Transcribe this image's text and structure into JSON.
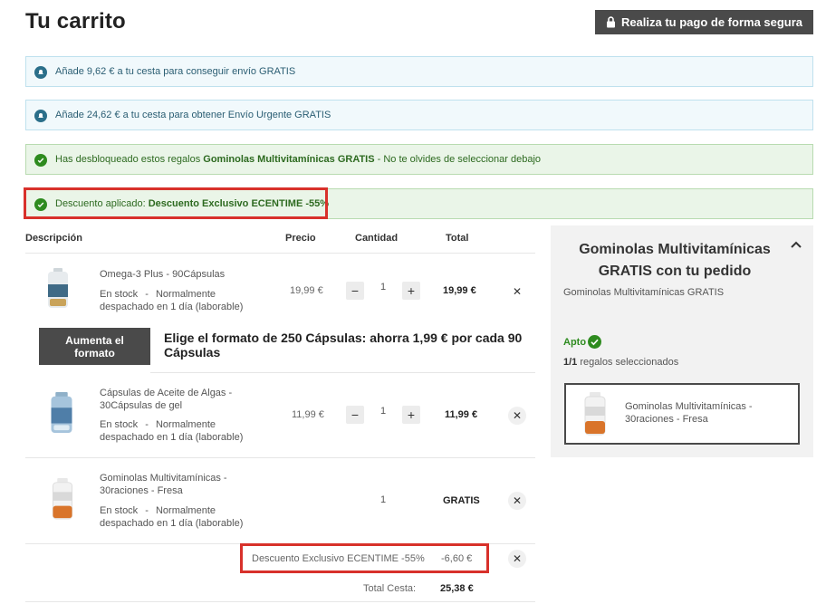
{
  "header": {
    "title": "Tu carrito",
    "secure_pay_label": "Realiza tu pago de forma segura"
  },
  "notices": [
    {
      "type": "info",
      "text": "Añade 9,62 € a tu cesta para conseguir envío GRATIS"
    },
    {
      "type": "info",
      "text": "Añade 24,62 € a tu cesta para obtener Envío Urgente GRATIS"
    },
    {
      "type": "ok",
      "prefix": "Has desbloqueado estos regalos ",
      "bold": "Gominolas Multivitamínicas GRATIS",
      "suffix": " - No te olvides de seleccionar debajo"
    },
    {
      "type": "ok",
      "prefix": "Descuento aplicado: ",
      "bold": "Descuento Exclusivo ECENTIME -55%"
    }
  ],
  "table": {
    "col_description": "Descripción",
    "col_price": "Precio",
    "col_quantity": "Cantidad",
    "col_total": "Total"
  },
  "items": [
    {
      "name": "Omega-3 Plus - 90Cápsulas",
      "stock": "En stock",
      "dash": "-",
      "delivery_1": "Normalmente",
      "delivery_2": "despachado en 1 día (laborable)",
      "price": "19,99 €",
      "qty": "1",
      "total": "19,99 €"
    },
    {
      "name_1": "Cápsulas de Aceite de Algas -",
      "name_2": "30Cápsulas de gel",
      "stock": "En stock",
      "dash": "-",
      "delivery_1": "Normalmente",
      "delivery_2": "despachado en 1 día (laborable)",
      "price": "11,99 €",
      "qty": "1",
      "total": "11,99 €"
    },
    {
      "name_1": "Gominolas Multivitamínicas -",
      "name_2": "30raciones - Fresa",
      "stock": "En stock",
      "dash": "-",
      "delivery_1": "Normalmente",
      "delivery_2": "despachado en 1 día (laborable)",
      "qty": "1",
      "total": "GRATIS"
    }
  ],
  "upgrade": {
    "button_label_1": "Aumenta el",
    "button_label_2": "formato",
    "text_pre": "Elige el formato de ",
    "text_bold": "250 Cápsulas: ahorra 1,99 € por cada 90 Cápsulas"
  },
  "discount_row": {
    "label": "Descuento Exclusivo ECENTIME -55%",
    "amount": "-6,60 €"
  },
  "basket_total": {
    "label": "Total Cesta:",
    "value": "25,38 €"
  },
  "sidebar": {
    "title": "Gominolas Multivitamínicas GRATIS con tu pedido",
    "subtitle": "Gominolas Multivitamínicas GRATIS",
    "apto": "Apto",
    "count_bold": "1/1",
    "count_text": " regalos seleccionados",
    "gift_name": "Gominolas Multivitamínicas - 30raciones - Fresa"
  },
  "icons": {
    "lock": "lock-icon",
    "info": "info-bell-icon",
    "check": "check-circle-icon",
    "remove": "close-icon",
    "chevron": "chevron-up-icon"
  },
  "colors": {
    "dark_button": "#4a4a4a",
    "highlight_red": "#d8312b",
    "success_green": "#2e8b1f",
    "info_blue": "#2b6f8a"
  }
}
